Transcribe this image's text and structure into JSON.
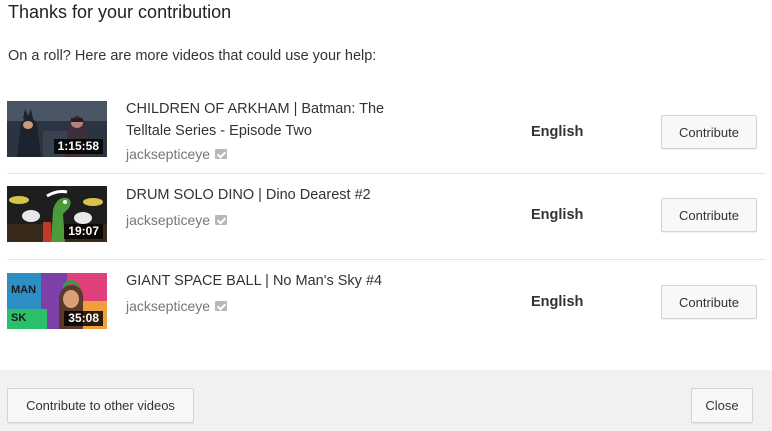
{
  "dialog": {
    "title": "Thanks for your contribution",
    "subtitle": "On a roll? Here are more videos that could use your help:"
  },
  "videos": [
    {
      "title": "CHILDREN OF ARKHAM | Batman: The Telltale Series - Episode Two",
      "channel": "jacksepticeye",
      "duration": "1:15:58",
      "language": "English",
      "button": "Contribute",
      "thumbnail": "batman-thumbnail"
    },
    {
      "title": "DRUM SOLO DINO | Dino Dearest #2",
      "channel": "jacksepticeye",
      "duration": "19:07",
      "language": "English",
      "button": "Contribute",
      "thumbnail": "dino-drums-thumbnail"
    },
    {
      "title": "GIANT SPACE BALL | No Man's Sky #4",
      "channel": "jacksepticeye",
      "duration": "35:08",
      "language": "English",
      "button": "Contribute",
      "thumbnail": "space-ball-thumbnail"
    }
  ],
  "footer": {
    "left_button": "Contribute to other videos",
    "right_button": "Close"
  },
  "colors": {
    "footer_bg": "#f1f1f1",
    "button_bg": "#f8f8f8",
    "channel_text": "#767676",
    "verified_badge": "#b8b8b8"
  }
}
